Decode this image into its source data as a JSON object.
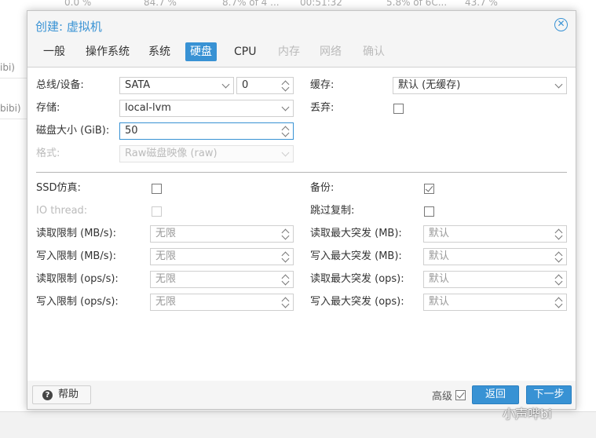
{
  "background": {
    "top_stats": [
      "0.0 %",
      "84.7 %",
      "8.7% of 4 ...",
      "00:51:32",
      "5.8% of 6C...",
      "43.7 %"
    ],
    "left_rows": [
      "ibi)",
      "bibi)"
    ]
  },
  "dialog": {
    "title": "创建: 虚拟机",
    "close_icon": "close-circle-icon",
    "tabs": [
      {
        "label": "一般",
        "state": "normal"
      },
      {
        "label": "操作系统",
        "state": "normal"
      },
      {
        "label": "系统",
        "state": "normal"
      },
      {
        "label": "硬盘",
        "state": "active"
      },
      {
        "label": "CPU",
        "state": "normal"
      },
      {
        "label": "内存",
        "state": "disabled"
      },
      {
        "label": "网络",
        "state": "disabled"
      },
      {
        "label": "确认",
        "state": "disabled"
      }
    ]
  },
  "form": {
    "bus_label": "总线/设备:",
    "bus_value": "SATA",
    "device_value": "0",
    "storage_label": "存储:",
    "storage_value": "local-lvm",
    "disk_size_label": "磁盘大小 (GiB):",
    "disk_size_value": "50",
    "format_label": "格式:",
    "format_value": "Raw磁盘映像 (raw)",
    "cache_label": "缓存:",
    "cache_value": "默认 (无缓存)",
    "discard_label": "丢弃:",
    "discard_checked": false
  },
  "advanced": {
    "ssd_label": "SSD仿真:",
    "ssd_checked": false,
    "io_thread_label": "IO thread:",
    "io_thread_checked": false,
    "backup_label": "备份:",
    "backup_checked": true,
    "skip_replication_label": "跳过复制:",
    "skip_replication_checked": false,
    "left_limits": [
      {
        "label": "读取限制 (MB/s):",
        "placeholder": "无限"
      },
      {
        "label": "写入限制 (MB/s):",
        "placeholder": "无限"
      },
      {
        "label": "读取限制 (ops/s):",
        "placeholder": "无限"
      },
      {
        "label": "写入限制 (ops/s):",
        "placeholder": "无限"
      }
    ],
    "right_limits": [
      {
        "label": "读取最大突发 (MB):",
        "placeholder": "默认"
      },
      {
        "label": "写入最大突发 (MB):",
        "placeholder": "默认"
      },
      {
        "label": "读取最大突发 (ops):",
        "placeholder": "默认"
      },
      {
        "label": "写入最大突发 (ops):",
        "placeholder": "默认"
      }
    ]
  },
  "footer": {
    "help_label": "帮助",
    "help_icon": "question-circle-icon",
    "advanced_label": "高级",
    "advanced_checked": true,
    "back_label": "返回",
    "next_label": "下一步"
  },
  "watermark": "小声哔bi",
  "colors": {
    "accent": "#3892d4",
    "dialog_bg": "#f5f5f5",
    "panel_bg": "#ffffff"
  }
}
